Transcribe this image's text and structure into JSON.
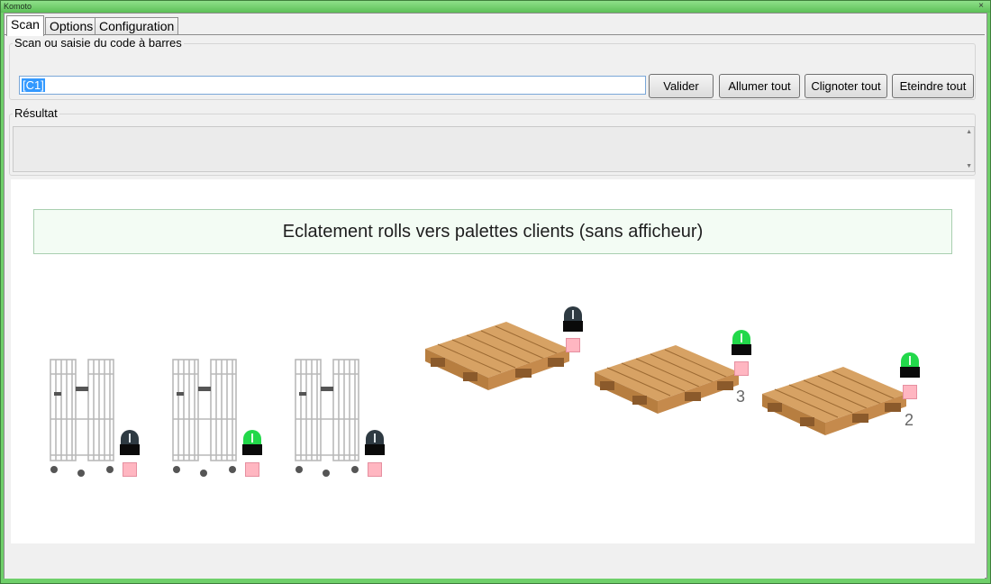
{
  "window": {
    "title": "Komoto",
    "close": "×"
  },
  "tabs": [
    {
      "label": "Scan"
    },
    {
      "label": "Options"
    },
    {
      "label": "Configuration"
    }
  ],
  "scan": {
    "group_label": "Scan ou saisie du code à barres",
    "input_value": "[C1]",
    "buttons": {
      "validate": "Valider",
      "all_on": "Allumer tout",
      "blink_all": "Clignoter tout",
      "all_off": "Eteindre tout"
    }
  },
  "result": {
    "group_label": "Résultat"
  },
  "scene": {
    "banner": "Eclatement rolls vers palettes clients (sans afficheur)",
    "rolls": [
      {
        "light": "off"
      },
      {
        "light": "on"
      },
      {
        "light": "off"
      }
    ],
    "pallets": [
      {
        "light": "off",
        "count": ""
      },
      {
        "light": "on",
        "count": "3"
      },
      {
        "light": "on",
        "count": "2"
      }
    ]
  },
  "colors": {
    "beacon_on": "#22d84a",
    "beacon_off": "#2e3a42",
    "indicator_square": "#ffb6c1",
    "banner_bg": "#f3fcf4"
  }
}
